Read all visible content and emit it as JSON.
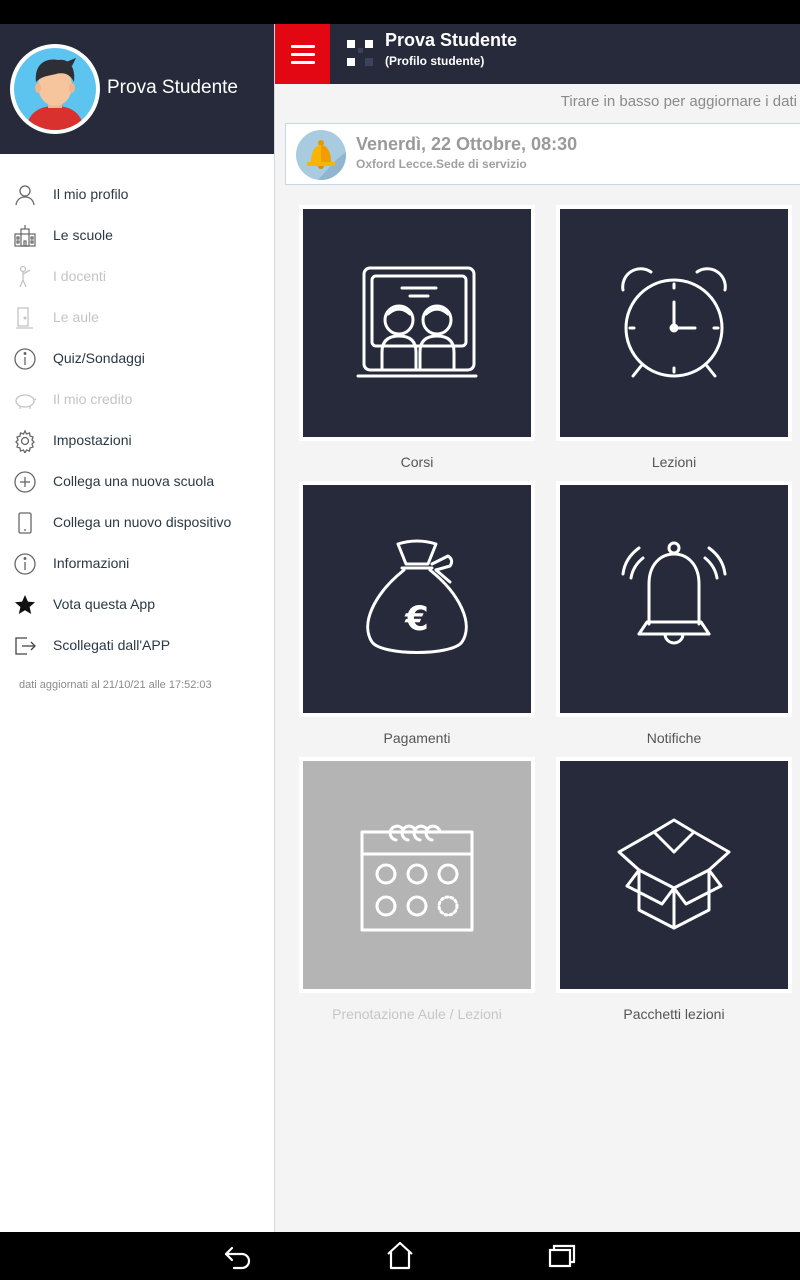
{
  "colors": {
    "dark": "#262a3a",
    "accent_red": "#e30613",
    "tile_disabled": "#b4b4b4"
  },
  "header": {
    "title": "Prova Studente",
    "subtitle": "(Profilo studente)",
    "menu_icon": "hamburger-menu-icon",
    "logo_icon": "app-logo-icon"
  },
  "refresh_hint": "Tirare in basso per aggiornare i dati",
  "notice": {
    "icon": "bell-icon",
    "date": "Venerdì, 22 Ottobre, 08:30",
    "place": "Oxford Lecce.Sede di servizio"
  },
  "tiles": [
    {
      "label": "Corsi",
      "icon": "classroom-icon",
      "enabled": true
    },
    {
      "label": "Lezioni",
      "icon": "alarm-clock-icon",
      "enabled": true
    },
    {
      "label": "Pagamenti",
      "icon": "money-bag-icon",
      "enabled": true
    },
    {
      "label": "Notifiche",
      "icon": "ringing-bell-icon",
      "enabled": true
    },
    {
      "label": "Prenotazione Aule / Lezioni",
      "icon": "calendar-icon",
      "enabled": false
    },
    {
      "label": "Pacchetti lezioni",
      "icon": "package-box-icon",
      "enabled": true
    }
  ],
  "drawer": {
    "user_name": "Prova Studente",
    "items": [
      {
        "label": "Il mio profilo",
        "icon": "user-icon",
        "enabled": true
      },
      {
        "label": "Le scuole",
        "icon": "school-building-icon",
        "enabled": true
      },
      {
        "label": "I docenti",
        "icon": "teacher-icon",
        "enabled": false
      },
      {
        "label": "Le aule",
        "icon": "classroom-door-icon",
        "enabled": false
      },
      {
        "label": "Quiz/Sondaggi",
        "icon": "info-circle-icon",
        "enabled": true
      },
      {
        "label": "Il mio credito",
        "icon": "piggy-bank-icon",
        "enabled": false
      },
      {
        "label": "Impostazioni",
        "icon": "gear-icon",
        "enabled": true
      },
      {
        "label": "Collega una nuova scuola",
        "icon": "plus-circle-icon",
        "enabled": true
      },
      {
        "label": "Collega un nuovo dispositivo",
        "icon": "smartphone-icon",
        "enabled": true
      },
      {
        "label": "Informazioni",
        "icon": "info-circle-icon",
        "enabled": true
      },
      {
        "label": "Vota questa App",
        "icon": "star-icon",
        "enabled": true
      },
      {
        "label": "Scollegati dall'APP",
        "icon": "logout-icon",
        "enabled": true
      }
    ],
    "footer": "dati aggiornati al 21/10/21 alle 17:52:03"
  },
  "navbar": {
    "back_icon": "back-icon",
    "home_icon": "home-icon",
    "recents_icon": "recent-apps-icon"
  }
}
